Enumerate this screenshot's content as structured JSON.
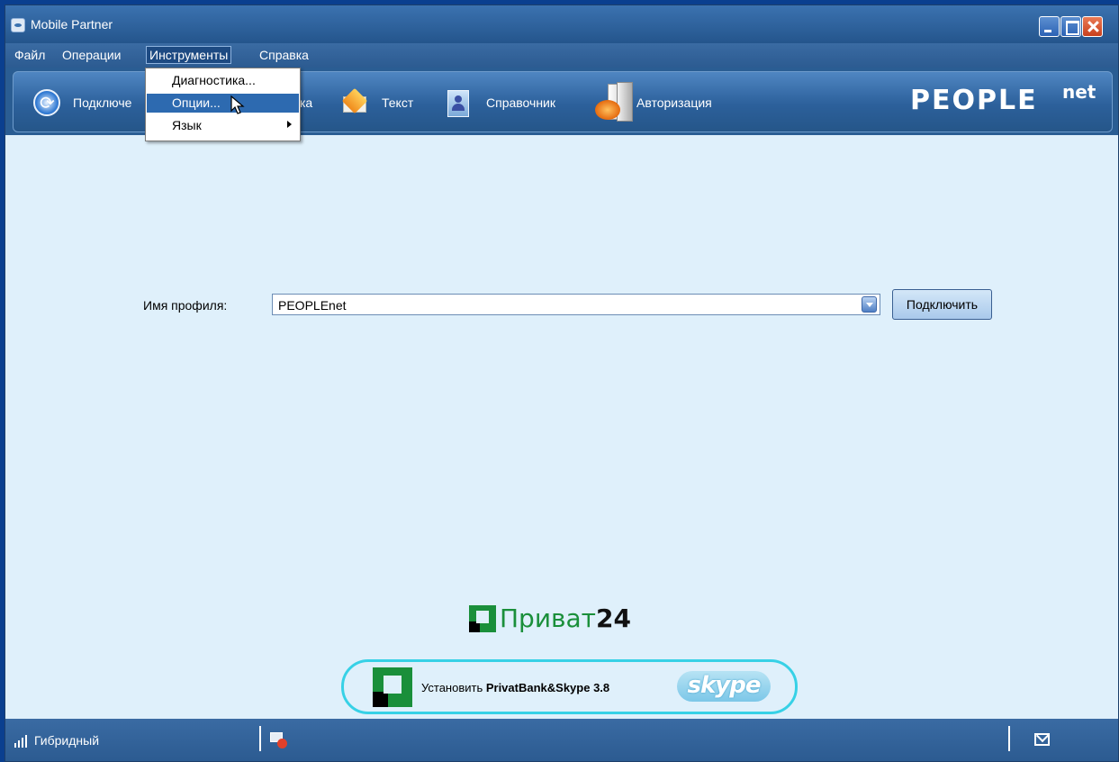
{
  "window": {
    "title": "Mobile Partner"
  },
  "menubar": {
    "items": [
      {
        "label": "Файл"
      },
      {
        "label": "Операции"
      },
      {
        "label": "Инструменты"
      },
      {
        "label": "Справка"
      }
    ]
  },
  "dropdown": {
    "items": [
      {
        "label": "Диагностика..."
      },
      {
        "label": "Опции..."
      },
      {
        "label": "Язык"
      }
    ]
  },
  "toolbar": {
    "items": [
      {
        "label": "Подключе",
        "icon": "connect-icon"
      },
      {
        "label": "ка",
        "icon": ""
      },
      {
        "label": "Текст",
        "icon": "envelope-icon"
      },
      {
        "label": "Справочник",
        "icon": "contacts-book-icon"
      },
      {
        "label": "Авторизация",
        "icon": "authorization-icon"
      }
    ],
    "brand": "PEOPLE",
    "brand_sup": "net"
  },
  "main": {
    "profile_label": "Имя профиля:",
    "profile_value": "PEOPLEnet",
    "connect_button": "Подключить"
  },
  "ads": {
    "privat_text": "Приват",
    "privat_num": "24",
    "banner_prefix": "Установить ",
    "banner_bold": "PrivatBank&Skype 3.8",
    "skype": "skype"
  },
  "statusbar": {
    "network_mode": "Гибридный"
  },
  "colors": {
    "accent": "#2a5d93",
    "content_bg": "#dff0fb",
    "privat_green": "#1a8f3a",
    "skype_border": "#37d1e6"
  }
}
